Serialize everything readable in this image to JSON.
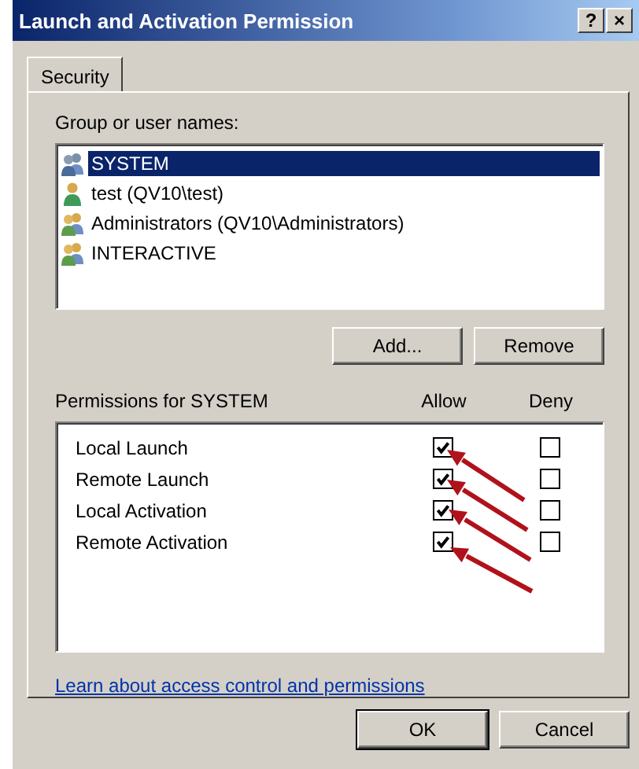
{
  "window": {
    "title": "Launch and Activation Permission",
    "help_button": "?",
    "close_button": "×"
  },
  "tabs": [
    {
      "label": "Security",
      "selected": true
    }
  ],
  "group_label": "Group or user names:",
  "users": [
    {
      "name": "SYSTEM",
      "kind": "group",
      "selected": true
    },
    {
      "name": "test (QV10\\test)",
      "kind": "user",
      "selected": false
    },
    {
      "name": "Administrators (QV10\\Administrators)",
      "kind": "group",
      "selected": false
    },
    {
      "name": "INTERACTIVE",
      "kind": "group",
      "selected": false
    }
  ],
  "user_buttons": [
    "Add...",
    "Remove"
  ],
  "permissions_label": "Permissions for SYSTEM",
  "columns": [
    "Allow",
    "Deny"
  ],
  "permissions": [
    {
      "name": "Local Launch",
      "allow": true,
      "deny": false
    },
    {
      "name": "Remote Launch",
      "allow": true,
      "deny": false
    },
    {
      "name": "Local Activation",
      "allow": true,
      "deny": false
    },
    {
      "name": "Remote Activation",
      "allow": true,
      "deny": false
    }
  ],
  "link": "Learn about access control and permissions",
  "buttons": [
    "OK",
    "Cancel"
  ]
}
